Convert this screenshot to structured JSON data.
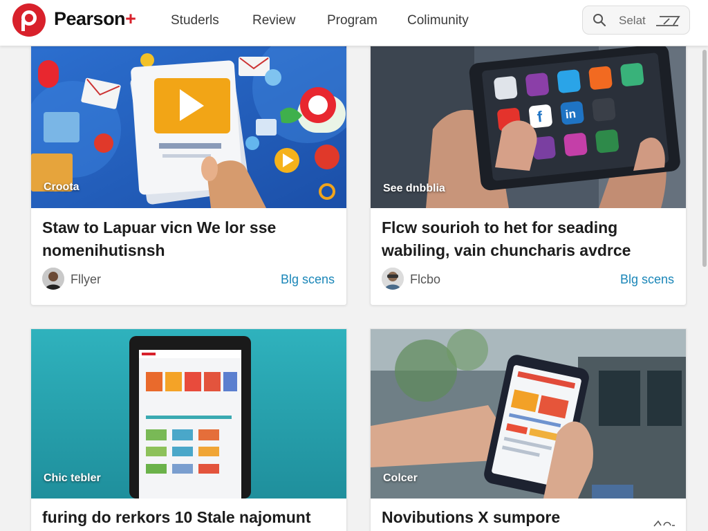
{
  "header": {
    "brand_name": "Pearson",
    "brand_plus": "+",
    "nav": [
      "Studerls",
      "Review",
      "Program",
      "Colimunity"
    ],
    "search_text": "Selat"
  },
  "cards": [
    {
      "image_label": "Croota",
      "title": "Staw to Lapuar vicn We lor sse nomenihutisnsh",
      "author": "Fllyer",
      "link": "Blg scens"
    },
    {
      "image_label": "See dnbblia",
      "title": "Flcw sourioh to het for seading wabiling, vain chuncharis avdrce",
      "author": "Flcbo",
      "link": "Blg scens"
    },
    {
      "image_label": "Chic tebler",
      "title": "furing do rerkors 10 Stale najomunt"
    },
    {
      "image_label": "Colcer",
      "title": "Novibutions X sumpore"
    }
  ],
  "colors": {
    "brand_red": "#d8212b",
    "link_blue": "#1a86b8"
  },
  "icons": [
    "pearson-logo-icon",
    "search-icon",
    "edit-icon",
    "avatar",
    "share-icon"
  ]
}
